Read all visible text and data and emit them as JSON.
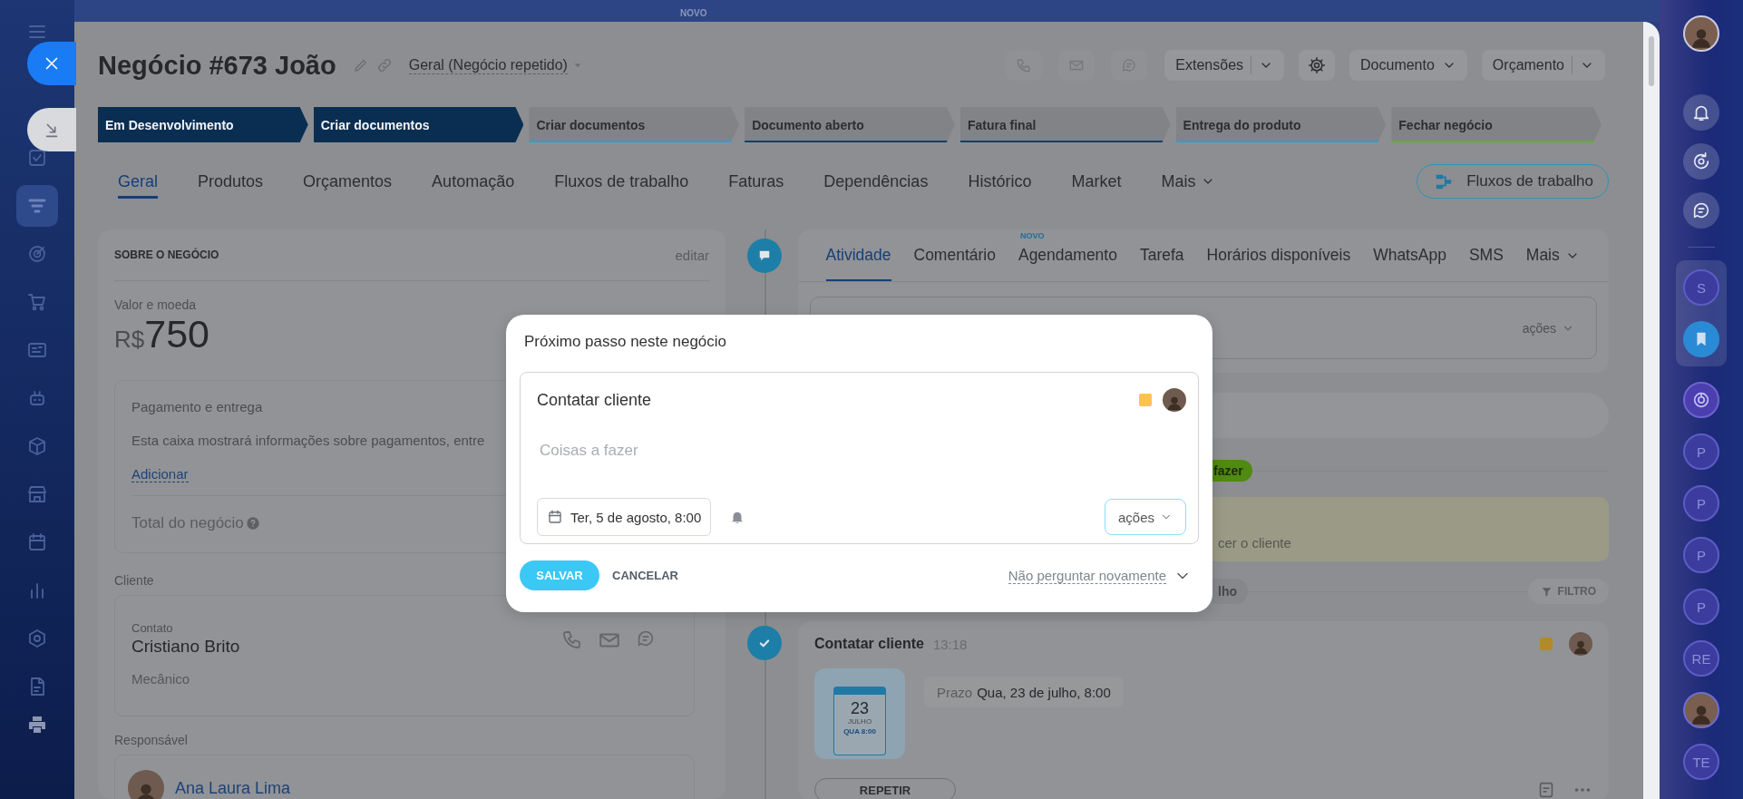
{
  "top_bar": {
    "badge": "NOVO"
  },
  "left_sidebar": {
    "items": [
      {
        "kind": "menu",
        "selected": false
      },
      {
        "kind": "check",
        "selected": false
      },
      {
        "kind": "filter",
        "selected": true
      },
      {
        "kind": "target",
        "selected": false
      },
      {
        "kind": "cart",
        "selected": false
      },
      {
        "kind": "idcard",
        "selected": false
      },
      {
        "kind": "robot",
        "selected": false
      },
      {
        "kind": "box",
        "selected": false
      },
      {
        "kind": "store",
        "selected": false
      },
      {
        "kind": "calendar",
        "selected": false
      },
      {
        "kind": "chart",
        "selected": false
      },
      {
        "kind": "hexagon",
        "selected": false
      },
      {
        "kind": "document",
        "selected": false
      }
    ],
    "bottom_items": [
      {
        "kind": "printer",
        "selected": false
      }
    ]
  },
  "deal": {
    "title": "Negócio #673 João",
    "category": "Geral (Negócio repetido)",
    "quick_actions": [
      {
        "kind": "phone",
        "disabled": true
      },
      {
        "kind": "mail",
        "disabled": true
      },
      {
        "kind": "chat",
        "disabled": true
      }
    ],
    "buttons": [
      {
        "kind": "split",
        "label": "Extensões"
      },
      {
        "kind": "settings"
      },
      {
        "kind": "dropdown",
        "label": "Documento"
      },
      {
        "kind": "split",
        "label": "Orçamento"
      }
    ],
    "stages": [
      {
        "label": "Em Desenvolvimento",
        "reached": true,
        "color": "#0a2e52"
      },
      {
        "label": "Criar documentos",
        "reached": true,
        "color": "#0a2e52"
      },
      {
        "label": "Criar documentos",
        "reached": false,
        "color": "#2aa0cf"
      },
      {
        "label": "Documento aberto",
        "reached": false,
        "color": "#123f6b"
      },
      {
        "label": "Fatura final",
        "reached": false,
        "color": "#123f6b"
      },
      {
        "label": "Entrega do produto",
        "reached": false,
        "color": "#2aa0cf"
      },
      {
        "label": "Fechar negócio",
        "reached": false,
        "color": "#6aae1e"
      }
    ],
    "tabs": [
      {
        "label": "Geral",
        "selected": true,
        "has_menu": false
      },
      {
        "label": "Produtos",
        "selected": false,
        "has_menu": false
      },
      {
        "label": "Orçamentos",
        "selected": false,
        "has_menu": false
      },
      {
        "label": "Automação",
        "selected": false,
        "has_menu": false
      },
      {
        "label": "Fluxos de trabalho",
        "selected": false,
        "has_menu": false
      },
      {
        "label": "Faturas",
        "selected": false,
        "has_menu": false
      },
      {
        "label": "Dependências",
        "selected": false,
        "has_menu": false
      },
      {
        "label": "Histórico",
        "selected": false,
        "has_menu": false
      },
      {
        "label": "Market",
        "selected": false,
        "has_menu": false
      },
      {
        "label": "Mais",
        "selected": false,
        "has_menu": true
      }
    ],
    "workflow_button": "Fluxos de trabalho",
    "about": {
      "heading": "SOBRE O NEGÓCIO",
      "edit_link": "editar",
      "amount_label": "Valor e moeda",
      "currency": "R$",
      "amount": "750",
      "payment": {
        "title": "Pagamento e entrega",
        "description": "Esta caixa mostrará informações sobre pagamentos, entre",
        "link": "Adicionar"
      },
      "total_label": "Total do negócio",
      "client_label": "Cliente",
      "contact": {
        "role": "Contato",
        "name": "Cristiano Brito",
        "position": "Mecânico"
      },
      "responsible_label": "Responsável",
      "responsible": {
        "name": "Ana Laura Lima"
      }
    },
    "activity": {
      "tabs": [
        {
          "label": "Atividade",
          "selected": true,
          "has_menu": false
        },
        {
          "label": "Comentário",
          "selected": false,
          "has_menu": false
        },
        {
          "label": "Agendamento",
          "selected": false,
          "has_menu": false,
          "badge": "NOVO"
        },
        {
          "label": "Tarefa",
          "selected": false,
          "has_menu": false
        },
        {
          "label": "Horários disponíveis",
          "selected": false,
          "has_menu": false
        },
        {
          "label": "WhatsApp",
          "selected": false,
          "has_menu": false
        },
        {
          "label": "SMS",
          "selected": false,
          "has_menu": false
        },
        {
          "label": "Mais",
          "selected": false,
          "has_menu": true
        }
      ],
      "composer_actions": "ações",
      "stage_badge": "fazer",
      "note_text": "cer o cliente",
      "period_pill": "lho",
      "filter_button": "FILTRO",
      "item": {
        "title": "Contatar cliente",
        "time": "13:18",
        "calendar": {
          "day": "23",
          "month": "JULHO",
          "weekday_time": "QUA 8:00"
        },
        "deadline_label": "Prazo",
        "deadline": "Qua, 23 de julho, 8:00",
        "repeat_button": "REPETIR"
      }
    }
  },
  "modal": {
    "title": "Próximo passo neste negócio",
    "task_title": "Contatar cliente",
    "placeholder": "Coisas a fazer",
    "date": "Ter, 5 de agosto, 8:00",
    "actions": "ações",
    "save": "SALVAR",
    "cancel": "CANCELAR",
    "dont_ask": "Não perguntar novamente"
  },
  "right_sidebar": {
    "top": [
      {
        "kind": "avatar"
      },
      {
        "kind": "bell"
      },
      {
        "kind": "sync"
      },
      {
        "kind": "chat"
      }
    ],
    "pinned": [
      {
        "kind": "letter",
        "label": "S",
        "selected": false
      },
      {
        "kind": "bookmark",
        "selected": true
      }
    ],
    "contacts": [
      {
        "kind": "copilot"
      },
      {
        "kind": "letter",
        "label": "P"
      },
      {
        "kind": "letter",
        "label": "P"
      },
      {
        "kind": "letter",
        "label": "P"
      },
      {
        "kind": "letter",
        "label": "P"
      },
      {
        "kind": "letter",
        "label": "RE"
      },
      {
        "kind": "avatar"
      },
      {
        "kind": "letter",
        "label": "TE"
      }
    ]
  }
}
